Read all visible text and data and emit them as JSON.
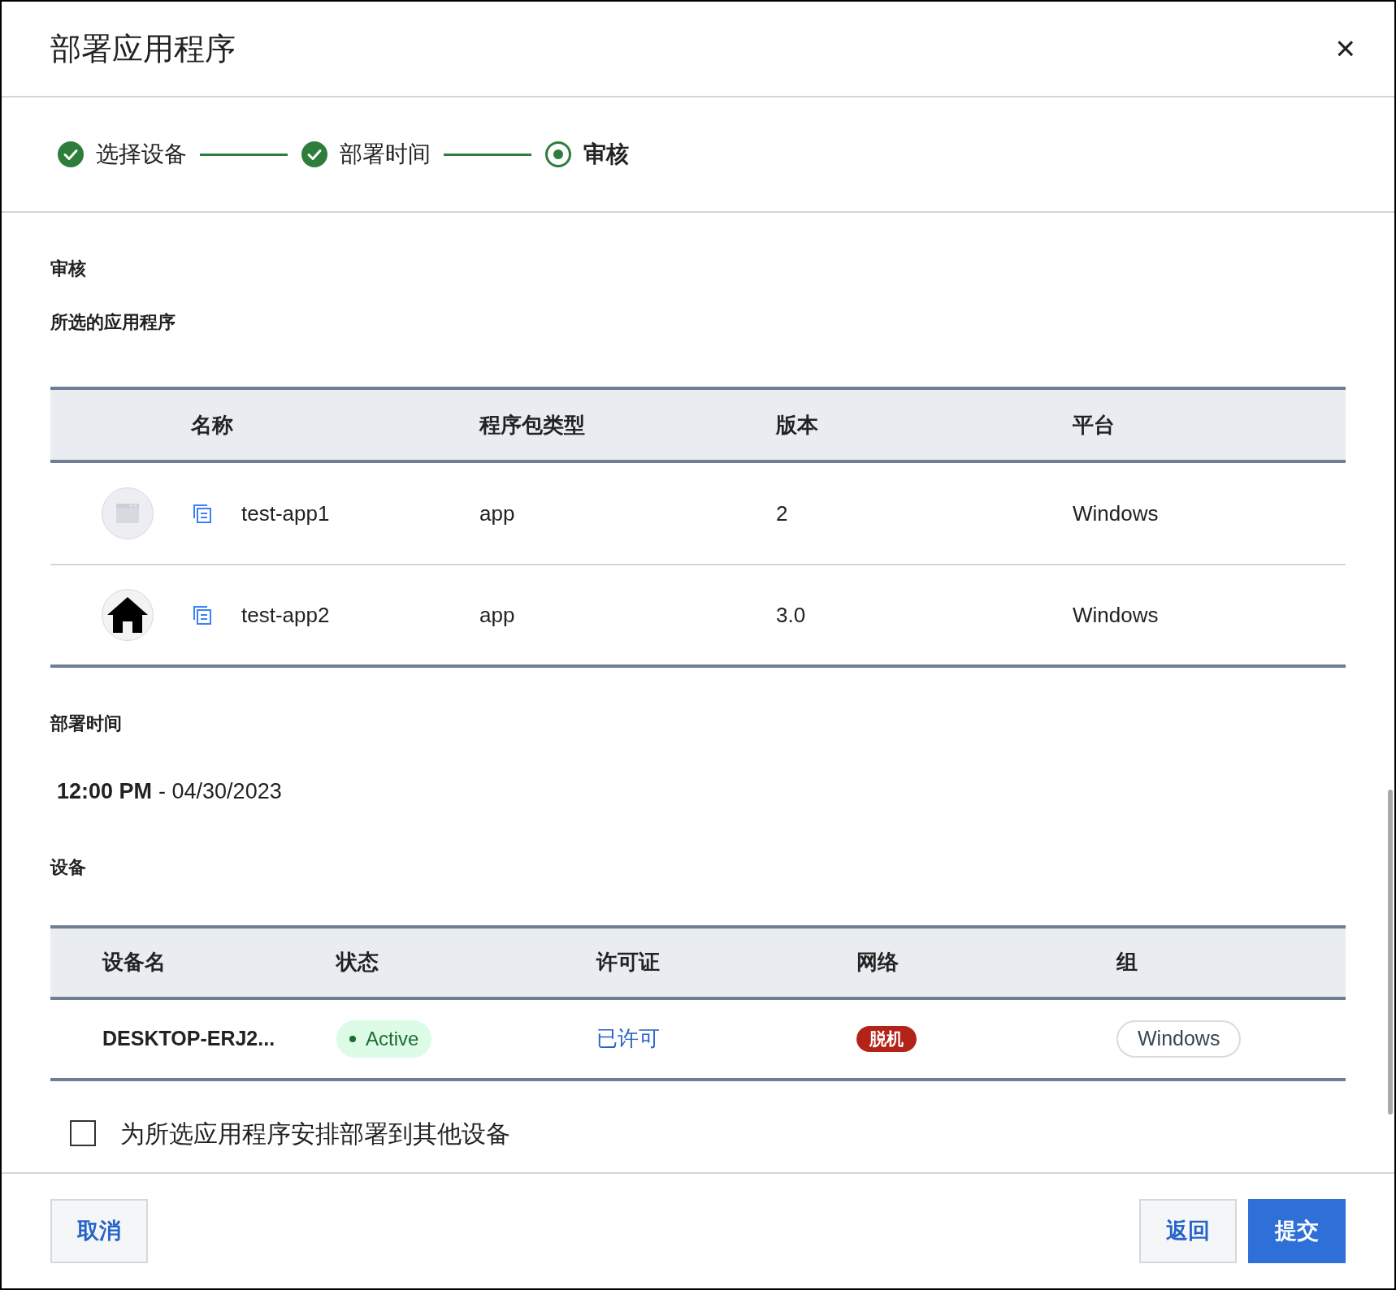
{
  "dialog": {
    "title": "部署应用程序",
    "close": "×"
  },
  "steps": [
    {
      "label": "选择设备",
      "completed": true,
      "selected": false
    },
    {
      "label": "部署时间",
      "completed": true,
      "selected": false
    },
    {
      "label": "审核",
      "completed": false,
      "selected": true
    }
  ],
  "review_heading": "审核",
  "apps": {
    "heading": "所选的应用程序",
    "columns": [
      "名称",
      "程序包类型",
      "版本",
      "平台"
    ],
    "rows": [
      {
        "kind": "placeholder",
        "name": "test-app1",
        "type": "app",
        "version": "2",
        "platform": "Windows"
      },
      {
        "kind": "house",
        "name": "test-app2",
        "type": "app",
        "version": "3.0",
        "platform": "Windows"
      }
    ]
  },
  "schedule": {
    "heading": "部署时间",
    "time": "12:00 PM",
    "date": "- 04/30/2023"
  },
  "devices": {
    "heading": "设备",
    "columns": [
      "设备名",
      "状态",
      "许可证",
      "网络",
      "组"
    ],
    "rows": [
      {
        "name": "DESKTOP-ERJ2...",
        "status": "Active",
        "license": "已许可",
        "network": "脱机",
        "group": "Windows"
      }
    ]
  },
  "other_devices": {
    "label": "为所选应用程序安排部署到其他设备",
    "checked": false
  },
  "buttons": {
    "cancel": "取消",
    "back": "返回",
    "submit": "提交"
  }
}
